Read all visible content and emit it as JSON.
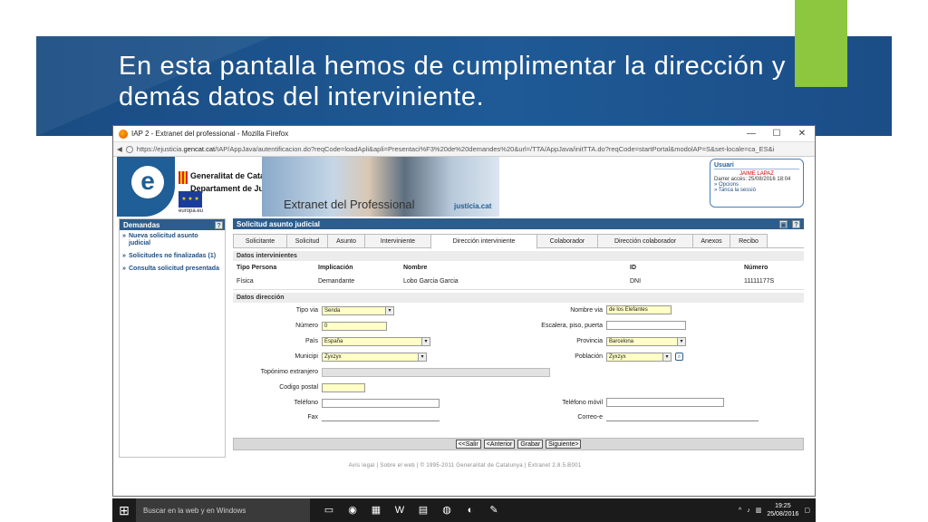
{
  "slide": {
    "title": "En esta pantalla hemos de cumplimentar la dirección y demás datos del interviniente."
  },
  "browser": {
    "title": "IAP 2 - Extranet del professional - Mozilla Firefox",
    "url_pre": "https://ejusticia.",
    "url_host": "gencat.cat",
    "url_post": "/IAP/AppJava/autentificacion.do?reqCode=loadApli&apli=Presentaci%F3%20de%20demandes%20&url=/TTA/AppJava/initTTA.do?reqCode=startPortal&modolAP=S&set-locale=ca_ES&i"
  },
  "header": {
    "gencat_line1": "Generalitat de Catalunya",
    "gencat_line2": "Departament de Justícia",
    "eu_label": "europa.eu",
    "extranet": "Extranet del Professional",
    "justicia": "justícia.cat",
    "user": {
      "heading": "Usuari",
      "name": "JAIME LAPAZ",
      "last_access": "Darrer accés: 25/08/2016 18:04",
      "options": "» Opcions",
      "logout": "» Tanca la sessió"
    }
  },
  "sidebar": {
    "heading": "Demandas",
    "items": [
      "Nueva solicitud asunto judicial",
      "Solicitudes no finalizadas (1)",
      "Consulta solicitud presentada"
    ]
  },
  "main": {
    "heading": "Solicitud asunto judicial",
    "tabs": [
      "Solicitante",
      "Solicitud",
      "Asunto",
      "Interviniente",
      "Dirección interviniente",
      "Colaborador",
      "Dirección colaborador",
      "Anexos",
      "Recibo"
    ],
    "section_intervinientes": "Datos intervinientes",
    "columns": [
      "Tipo Persona",
      "Implicación",
      "Nombre",
      "ID",
      "Número"
    ],
    "row": [
      "Física",
      "Demandante",
      "Lobo Garcia Garcia",
      "DNI",
      "11111177S"
    ],
    "section_direccion": "Datos dirección",
    "form": {
      "tipo_via_label": "Tipo via",
      "tipo_via": "Senda",
      "nombre_via_label": "Nombre via",
      "nombre_via": "de los Elefantes",
      "numero_label": "Número",
      "numero": "0",
      "escalera_label": "Escalera, piso, puerta",
      "escalera": "",
      "pais_label": "País",
      "pais": "España",
      "provincia_label": "Provincia",
      "provincia": "Barcelona",
      "municipi_label": "Municipi",
      "municipi": "Zyxzyx",
      "poblacion_label": "Población",
      "poblacion": "Zyxzyx",
      "toponimo_label": "Topónimo extranjero",
      "codigo_postal_label": "Codigo postal",
      "telefono_label": "Teléfono",
      "telefono_movil_label": "Teléfono móvil",
      "fax_label": "Fax",
      "correo_label": "Correo-e"
    },
    "buttons": [
      "<<Salir",
      "<Anterior",
      "Grabar",
      "Siguiente>"
    ],
    "footer": "Avís legal  |  Sobre el web  |  © 1995-2011 Generalitat de Catalunya  |  Extranet 2.8.5.B001"
  },
  "taskbar": {
    "search": "Buscar en la web y en Windows",
    "time": "19:25",
    "date": "25/08/2016"
  },
  "colors": {
    "banner": "#1f5a96",
    "accent_green": "#8dc63f",
    "header_blue": "#2e5d8c"
  }
}
